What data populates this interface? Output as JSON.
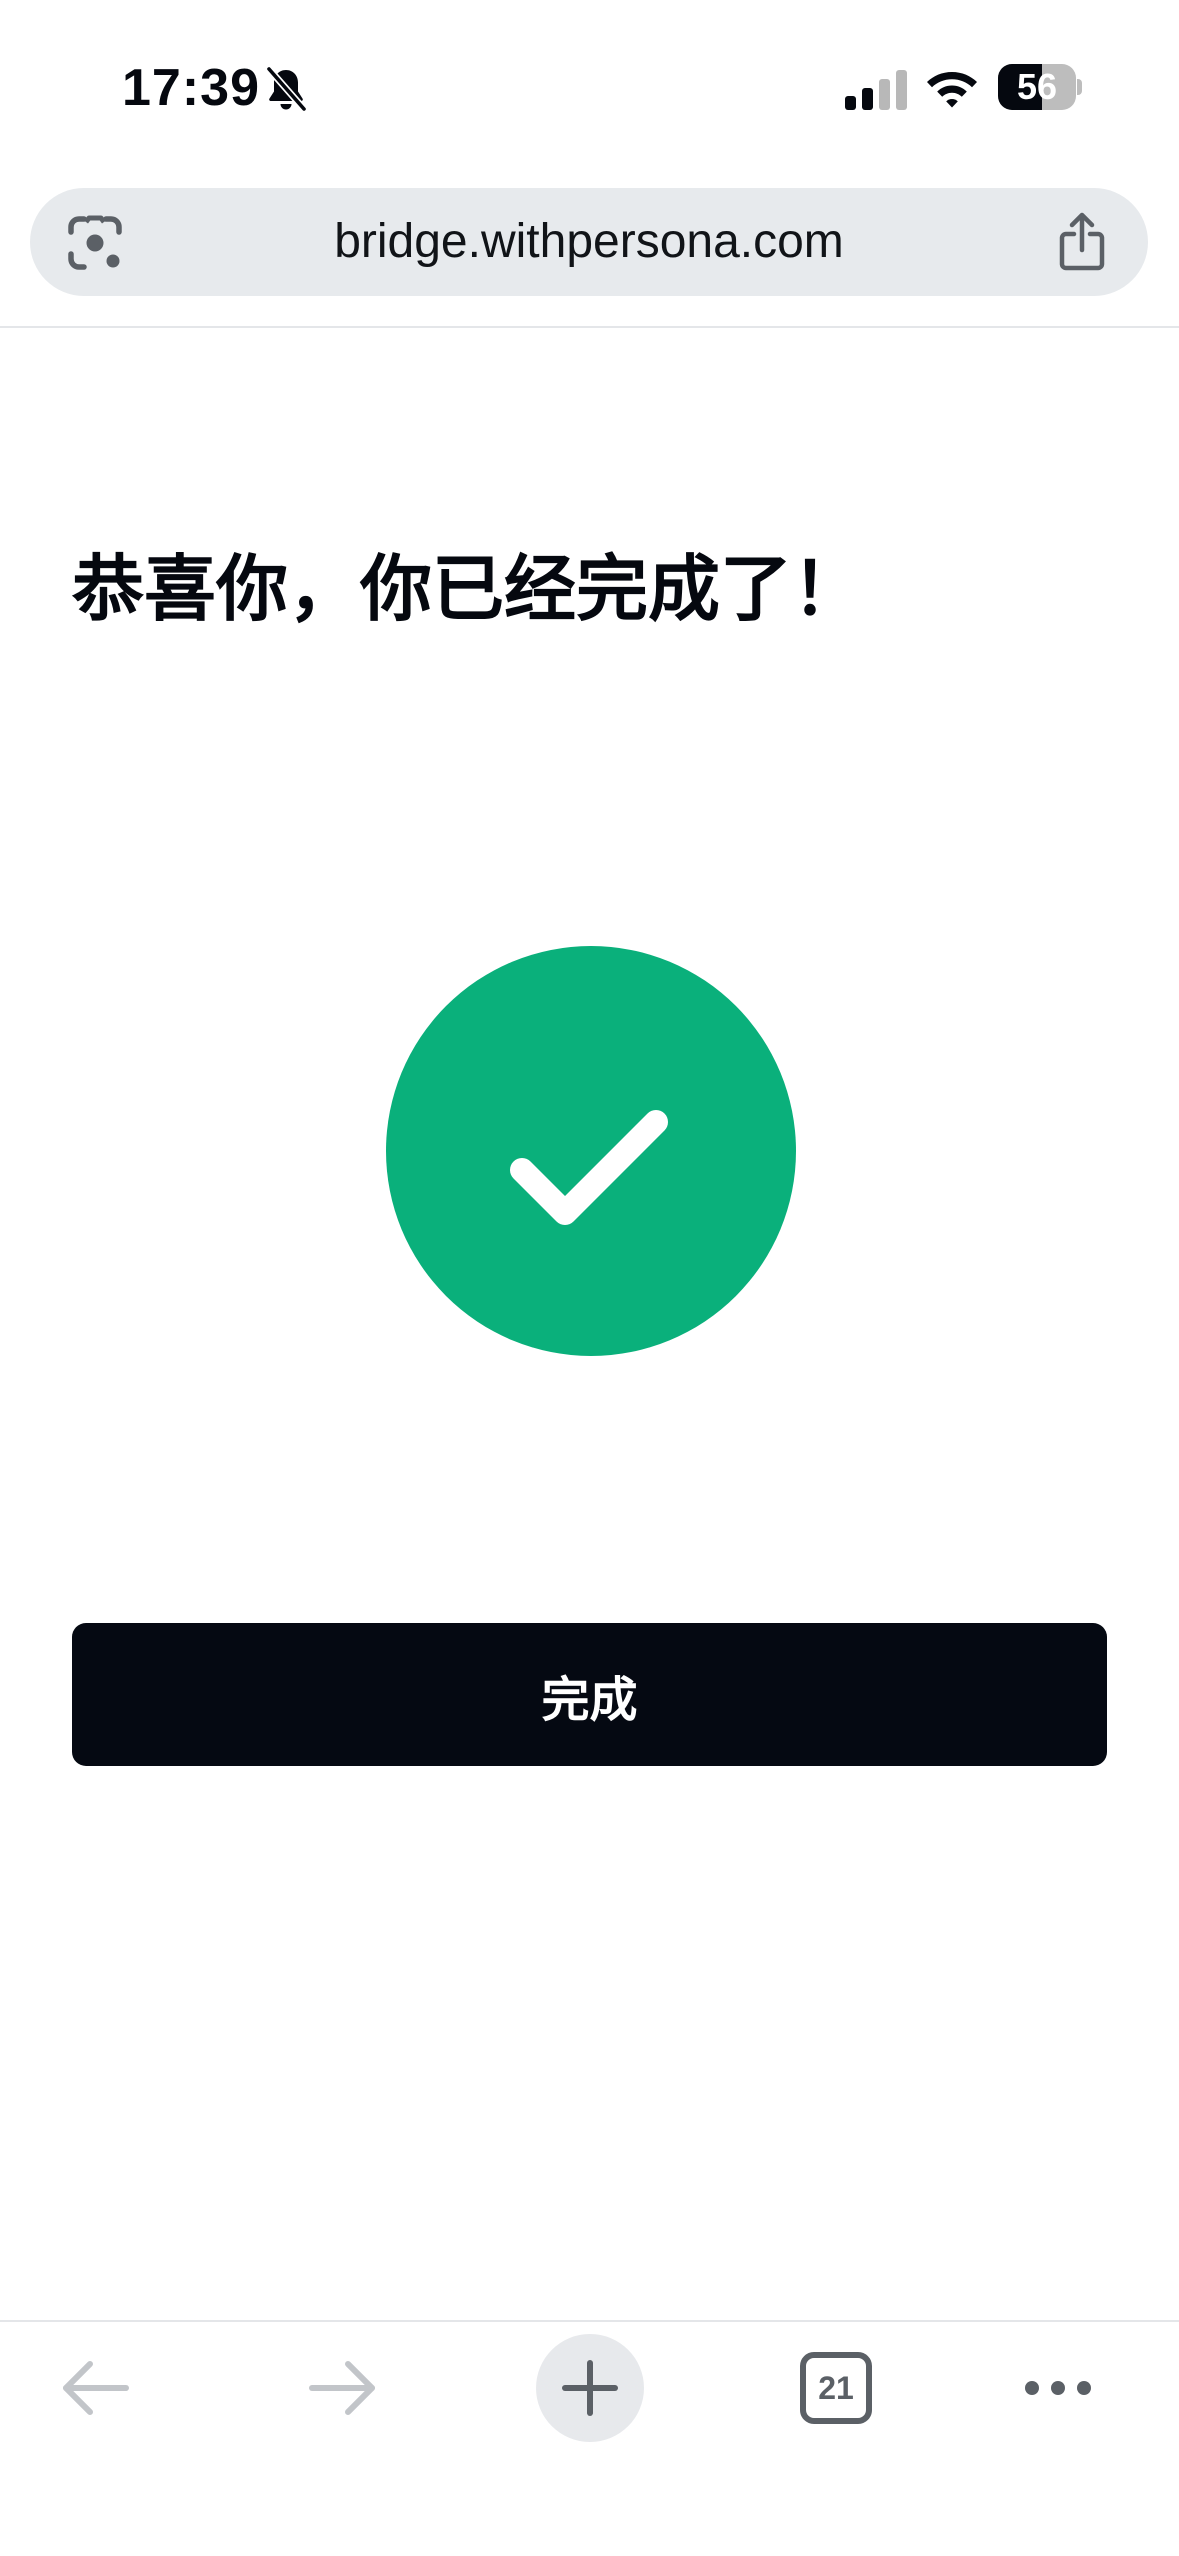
{
  "status_bar": {
    "time": "17:39",
    "battery_level": "56",
    "battery_fraction": 0.56
  },
  "browser": {
    "url": "bridge.withpersona.com",
    "open_tab_count": "21"
  },
  "content": {
    "title": "恭喜你，你已经完成了！",
    "done_button_label": "完成",
    "success_color": "#0ab07b",
    "button_color": "#050912"
  },
  "icons": {
    "status": [
      "bell-slash-icon",
      "cellular-signal-icon",
      "wifi-icon",
      "battery-icon"
    ],
    "url_bar": [
      "lens-camera-icon",
      "share-icon"
    ],
    "content": [
      "checkmark-icon"
    ],
    "toolbar": [
      "back-arrow-icon",
      "forward-arrow-icon",
      "plus-icon",
      "tab-switcher-icon",
      "more-dots-icon"
    ]
  }
}
